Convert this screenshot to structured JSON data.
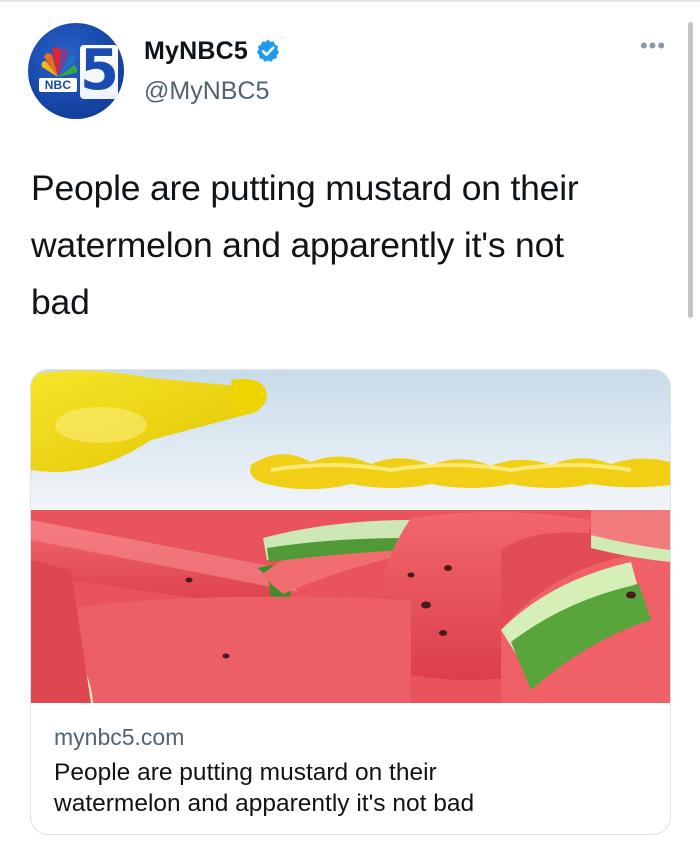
{
  "account": {
    "display_name": "MyNBC5",
    "handle": "@MyNBC5",
    "verified": true,
    "avatar": {
      "network_text": "NBC",
      "channel_number": "5"
    }
  },
  "menu": {
    "more_label": "•••"
  },
  "tweet": {
    "text": "People are putting mustard on their\nwatermelon and apparently it's not\nbad"
  },
  "link_card": {
    "image_icon": "mustard-on-watermelon-photo",
    "domain": "mynbc5.com",
    "title": "People are putting mustard on their\nwatermelon and apparently it's not bad"
  },
  "colors": {
    "verified_blue": "#1d9bf0",
    "avatar_blue": "#1647a8",
    "secondary_text": "#536471",
    "border": "#dfe3e6"
  }
}
